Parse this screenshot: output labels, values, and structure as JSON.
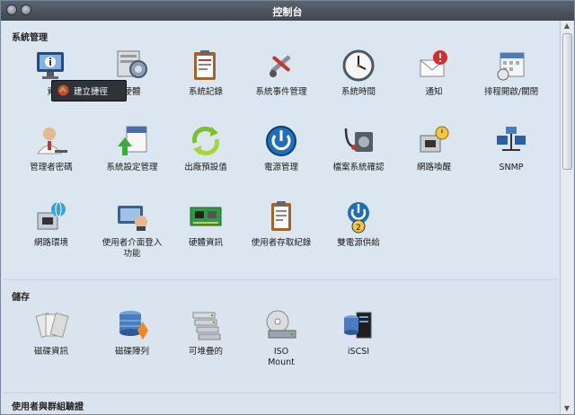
{
  "window": {
    "title": "控制台"
  },
  "tooltip": {
    "label": "建立捷徑"
  },
  "sections": [
    {
      "title": "系統管理",
      "items": [
        {
          "label": "資",
          "icon": "info-monitor-icon"
        },
        {
          "label": "硬體",
          "icon": "hardware-settings-icon"
        },
        {
          "label": "系統記錄",
          "icon": "clipboard-log-icon"
        },
        {
          "label": "系統事件管理",
          "icon": "event-tools-icon"
        },
        {
          "label": "系統時間",
          "icon": "clock-icon"
        },
        {
          "label": "通知",
          "icon": "notification-icon"
        },
        {
          "label": "排程開啟/關閉",
          "icon": "schedule-calendar-icon"
        },
        {
          "label": "管理者密碼",
          "icon": "admin-user-icon"
        },
        {
          "label": "系統設定管理",
          "icon": "config-icon"
        },
        {
          "label": "出廠預設值",
          "icon": "reset-arrows-icon"
        },
        {
          "label": "電源管理",
          "icon": "power-icon"
        },
        {
          "label": "檔案系統確認",
          "icon": "stethoscope-icon"
        },
        {
          "label": "網路喚醒",
          "icon": "wake-on-lan-icon"
        },
        {
          "label": "SNMP",
          "icon": "snmp-network-icon"
        },
        {
          "label": "網路環境",
          "icon": "network-globe-icon"
        },
        {
          "label": "使用者介面登入\n功能",
          "icon": "ui-login-icon"
        },
        {
          "label": "硬體資訊",
          "icon": "circuit-board-icon"
        },
        {
          "label": "使用者存取紀錄",
          "icon": "access-log-icon"
        },
        {
          "label": "雙電源供給",
          "icon": "dual-power-icon"
        }
      ]
    },
    {
      "title": "儲存",
      "items": [
        {
          "label": "磁碟資訊",
          "icon": "disks-icon"
        },
        {
          "label": "磁碟陣列",
          "icon": "raid-icon"
        },
        {
          "label": "可堆疊的",
          "icon": "stackable-icon"
        },
        {
          "label": "ISO\nMount",
          "icon": "iso-mount-icon"
        },
        {
          "label": "iSCSI",
          "icon": "iscsi-icon"
        }
      ]
    },
    {
      "title": "使用者與群組驗證",
      "items": []
    }
  ]
}
